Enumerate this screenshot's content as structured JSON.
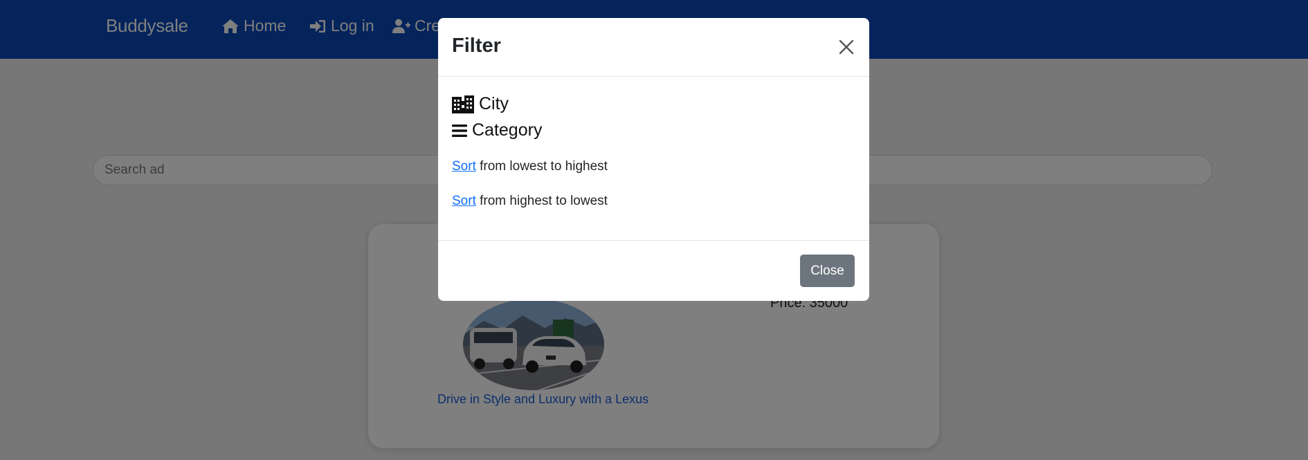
{
  "navbar": {
    "brand": "Buddysale",
    "links": [
      {
        "label": "Home",
        "icon": "home-icon"
      },
      {
        "label": "Log in",
        "icon": "sign-in-icon"
      },
      {
        "label": "Cre",
        "icon": "user-plus-icon"
      }
    ]
  },
  "search": {
    "placeholder": "Search ad"
  },
  "ad": {
    "title": "Drive in Style and Luxury with a Lexus",
    "price": "Price: 35000"
  },
  "modal": {
    "title": "Filter",
    "filters": [
      {
        "label": "City",
        "icon": "city-icon"
      },
      {
        "label": "Category",
        "icon": "bars-icon"
      }
    ],
    "sort_options": [
      {
        "link": "Sort",
        "text": " from lowest to highest"
      },
      {
        "link": "Sort",
        "text": " from highest to lowest"
      }
    ],
    "close_label": "Close"
  },
  "colors": {
    "navbar": "#0a48b8",
    "link": "#0d6efd",
    "close_button": "#6c757d"
  }
}
